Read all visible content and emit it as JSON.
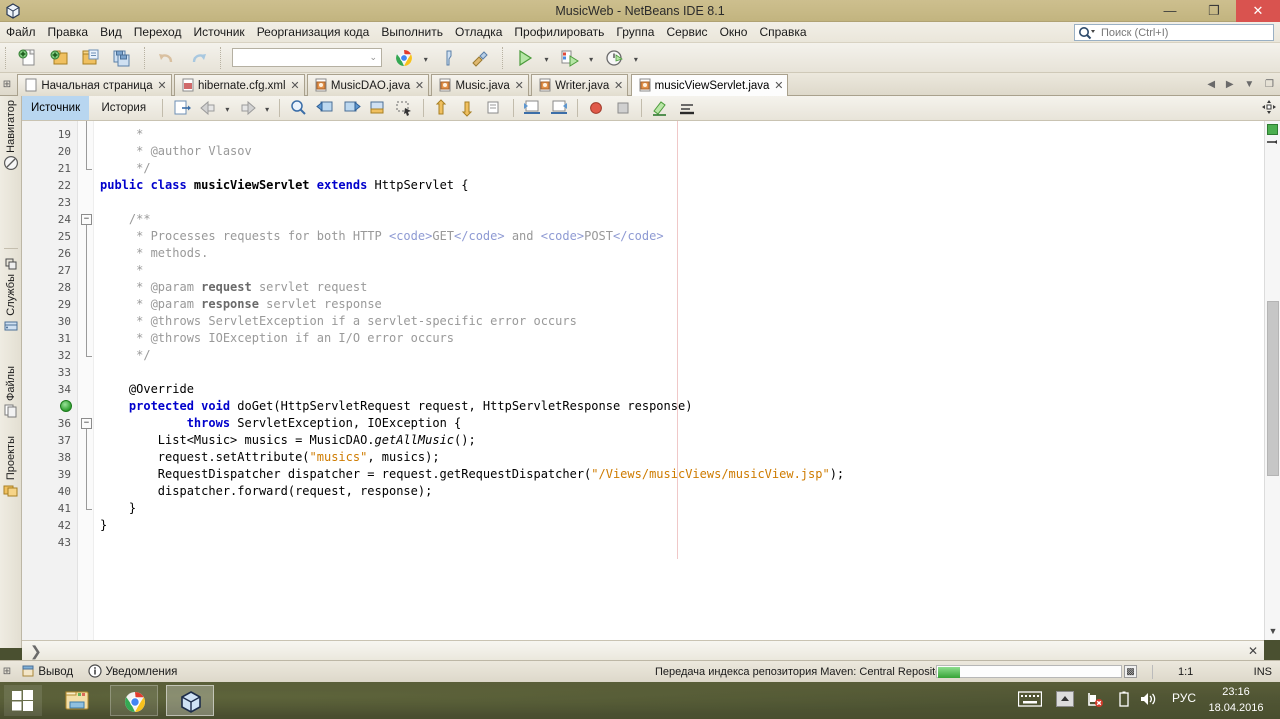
{
  "window": {
    "title": "MusicWeb - NetBeans IDE 8.1",
    "app_icon": "netbeans-cube-icon",
    "minimize_label": "—",
    "maximize_label": "❐",
    "close_label": "✕"
  },
  "menubar": {
    "items": [
      "Файл",
      "Правка",
      "Вид",
      "Переход",
      "Источник",
      "Реорганизация кода",
      "Выполнить",
      "Отладка",
      "Профилировать",
      "Группа",
      "Сервис",
      "Окно",
      "Справка"
    ],
    "search": {
      "placeholder": "Поиск (Ctrl+I)",
      "value": "",
      "icon": "search-icon"
    }
  },
  "toolbar": {
    "buttons": [
      {
        "name": "new-file-icon",
        "title": "Новый файл"
      },
      {
        "name": "new-project-icon",
        "title": "Новый проект"
      },
      {
        "name": "open-project-icon",
        "title": "Открыть проект"
      },
      {
        "name": "save-all-icon",
        "title": "Сохранить все"
      },
      {
        "name": "undo-icon",
        "title": "Отменить"
      },
      {
        "name": "redo-icon",
        "title": "Вернуть"
      }
    ],
    "config_combo": {
      "value": "",
      "placeholder": ""
    },
    "run_buttons": [
      {
        "name": "browser-chrome-icon"
      },
      {
        "name": "clean-build-icon"
      },
      {
        "name": "build-icon"
      },
      {
        "name": "run-project-icon"
      },
      {
        "name": "debug-project-icon"
      },
      {
        "name": "profile-project-icon"
      }
    ]
  },
  "document_tabs": {
    "items": [
      {
        "label": "Начальная страница",
        "icon": "page-icon",
        "active": false
      },
      {
        "label": "hibernate.cfg.xml",
        "icon": "xml-file-icon",
        "active": false
      },
      {
        "label": "MusicDAO.java",
        "icon": "java-file-icon",
        "active": false
      },
      {
        "label": "Music.java",
        "icon": "java-file-icon",
        "active": false
      },
      {
        "label": "Writer.java",
        "icon": "java-file-icon",
        "active": false
      },
      {
        "label": "musicViewServlet.java",
        "icon": "java-file-icon",
        "active": true
      }
    ],
    "close_glyph": "✕",
    "scroll_left": "◀",
    "scroll_right": "▶",
    "list_glyph": "▼",
    "maximize_glyph": "❐"
  },
  "editor_toolbar": {
    "tabs": [
      {
        "label": "Источник",
        "selected": true
      },
      {
        "label": "История",
        "selected": false
      }
    ],
    "buttons": [
      {
        "name": "refactor-icon"
      },
      {
        "name": "back-icon"
      },
      {
        "name": "forward-icon"
      },
      {
        "name": "find-selection-icon"
      },
      {
        "name": "previous-bookmark-icon"
      },
      {
        "name": "next-bookmark-icon"
      },
      {
        "name": "toggle-bookmark-icon"
      },
      {
        "name": "toggle-rectangular-selection-icon"
      },
      {
        "name": "shift-line-left-icon"
      },
      {
        "name": "shift-line-right-icon"
      },
      {
        "name": "start-macro-recording-icon"
      },
      {
        "name": "stop-macro-recording-icon"
      },
      {
        "name": "comment-icon"
      },
      {
        "name": "uncomment-icon"
      },
      {
        "name": "toggle-highlight-icon"
      }
    ],
    "right_button": {
      "name": "expand-editor-icon"
    }
  },
  "sidebar": {
    "items": [
      {
        "label": "Навигатор",
        "icon": "navigator-icon"
      },
      {
        "label": "Службы",
        "icon": "services-icon"
      },
      {
        "label": "Файлы",
        "icon": "files-icon"
      },
      {
        "label": "Проекты",
        "icon": "projects-icon"
      }
    ]
  },
  "editor": {
    "first_line": 19,
    "lines": [
      {
        "n": 19,
        "segments": [
          {
            "t": "     *",
            "c": "cmt"
          }
        ]
      },
      {
        "n": 20,
        "segments": [
          {
            "t": "     * @author Vlasov",
            "c": "cmt"
          }
        ]
      },
      {
        "n": 21,
        "segments": [
          {
            "t": "     */",
            "c": "cmt"
          }
        ]
      },
      {
        "n": 22,
        "segments": [
          {
            "t": "public class ",
            "c": "kw"
          },
          {
            "t": "musicViewServlet ",
            "c": "bld"
          },
          {
            "t": "extends ",
            "c": "kw"
          },
          {
            "t": "HttpServlet {",
            "c": ""
          }
        ]
      },
      {
        "n": 23,
        "segments": []
      },
      {
        "n": 24,
        "segments": [
          {
            "t": "    /**",
            "c": "cmt"
          }
        ]
      },
      {
        "n": 25,
        "segments": [
          {
            "t": "     * Processes requests for both HTTP ",
            "c": "cmt"
          },
          {
            "t": "<code>",
            "c": "cmtt"
          },
          {
            "t": "GET",
            "c": "cmt"
          },
          {
            "t": "</code>",
            "c": "cmtt"
          },
          {
            "t": " and ",
            "c": "cmt"
          },
          {
            "t": "<code>",
            "c": "cmtt"
          },
          {
            "t": "POST",
            "c": "cmt"
          },
          {
            "t": "</code>",
            "c": "cmtt"
          }
        ]
      },
      {
        "n": 26,
        "segments": [
          {
            "t": "     * methods.",
            "c": "cmt"
          }
        ]
      },
      {
        "n": 27,
        "segments": [
          {
            "t": "     *",
            "c": "cmt"
          }
        ]
      },
      {
        "n": 28,
        "segments": [
          {
            "t": "     * @param ",
            "c": "cmt"
          },
          {
            "t": "request",
            "c": "cmtb"
          },
          {
            "t": " servlet request",
            "c": "cmt"
          }
        ]
      },
      {
        "n": 29,
        "segments": [
          {
            "t": "     * @param ",
            "c": "cmt"
          },
          {
            "t": "response",
            "c": "cmtb"
          },
          {
            "t": " servlet response",
            "c": "cmt"
          }
        ]
      },
      {
        "n": 30,
        "segments": [
          {
            "t": "     * @throws ServletException if a servlet-specific error occurs",
            "c": "cmt"
          }
        ]
      },
      {
        "n": 31,
        "segments": [
          {
            "t": "     * @throws IOException if an I/O error occurs",
            "c": "cmt"
          }
        ]
      },
      {
        "n": 32,
        "segments": [
          {
            "t": "     */",
            "c": "cmt"
          }
        ]
      },
      {
        "n": 33,
        "segments": []
      },
      {
        "n": 34,
        "segments": [
          {
            "t": "    @Override",
            "c": ""
          }
        ]
      },
      {
        "n": 35,
        "segments": [
          {
            "t": "    protected void ",
            "c": "kw"
          },
          {
            "t": "doGet(HttpServletRequest request, HttpServletResponse response)",
            "c": ""
          }
        ]
      },
      {
        "n": 36,
        "segments": [
          {
            "t": "            ",
            "c": ""
          },
          {
            "t": "throws ",
            "c": "kw"
          },
          {
            "t": "ServletException, IOException {",
            "c": ""
          }
        ]
      },
      {
        "n": 37,
        "segments": [
          {
            "t": "        List<Music> musics = MusicDAO.",
            "c": ""
          },
          {
            "t": "getAllMusic",
            "c": "ital"
          },
          {
            "t": "();",
            "c": ""
          }
        ]
      },
      {
        "n": 38,
        "segments": [
          {
            "t": "        request.setAttribute(",
            "c": ""
          },
          {
            "t": "\"musics\"",
            "c": "str"
          },
          {
            "t": ", musics);",
            "c": ""
          }
        ]
      },
      {
        "n": 39,
        "segments": [
          {
            "t": "        RequestDispatcher dispatcher = request.getRequestDispatcher(",
            "c": ""
          },
          {
            "t": "\"/Views/musicViews/musicView.jsp\"",
            "c": "str"
          },
          {
            "t": ");",
            "c": ""
          }
        ]
      },
      {
        "n": 40,
        "segments": [
          {
            "t": "        dispatcher.forward(request, response);",
            "c": ""
          }
        ]
      },
      {
        "n": 41,
        "segments": [
          {
            "t": "    }",
            "c": ""
          }
        ]
      },
      {
        "n": 42,
        "segments": [
          {
            "t": "}",
            "c": ""
          }
        ]
      },
      {
        "n": 43,
        "segments": []
      }
    ],
    "fold_markers": [
      {
        "line": 24,
        "glyph": "−"
      },
      {
        "line": 36,
        "glyph": "−"
      }
    ],
    "override_indicator_line": 35,
    "scrollbar": {
      "up_arrow": "▲",
      "down_arrow": "▼",
      "error_stripe_color": "#4caf50"
    }
  },
  "bottom_windows": {
    "tabs": [
      {
        "label": "Вывод",
        "icon": "output-icon"
      },
      {
        "label": "Уведомления",
        "icon": "notifications-icon"
      }
    ]
  },
  "status_bar": {
    "message": "Передача индекса репозитория Maven: Central Repository",
    "progress_percent": 12,
    "stop_glyph": "▩",
    "caret_position": "1:1",
    "insert_mode": "INS"
  },
  "taskbar": {
    "start_icon": "windows-start-icon",
    "items": [
      {
        "name": "file-explorer-icon",
        "active": false
      },
      {
        "name": "google-chrome-icon",
        "active": false
      },
      {
        "name": "netbeans-icon",
        "active": true
      }
    ],
    "tray": [
      {
        "name": "keyboard-icon"
      },
      {
        "name": "show-hidden-icons-icon"
      },
      {
        "name": "network-error-icon"
      },
      {
        "name": "battery-icon"
      },
      {
        "name": "volume-icon"
      }
    ],
    "language": "РУС",
    "time": "23:16",
    "date": "18.04.2016"
  },
  "colors": {
    "titlebar": "#c8ba87",
    "accent_blue": "#0000cc",
    "string_orange": "#ce7b00",
    "comment_gray": "#999999",
    "selected_tab": "#b8d6f0",
    "close_red": "#d9534f"
  }
}
